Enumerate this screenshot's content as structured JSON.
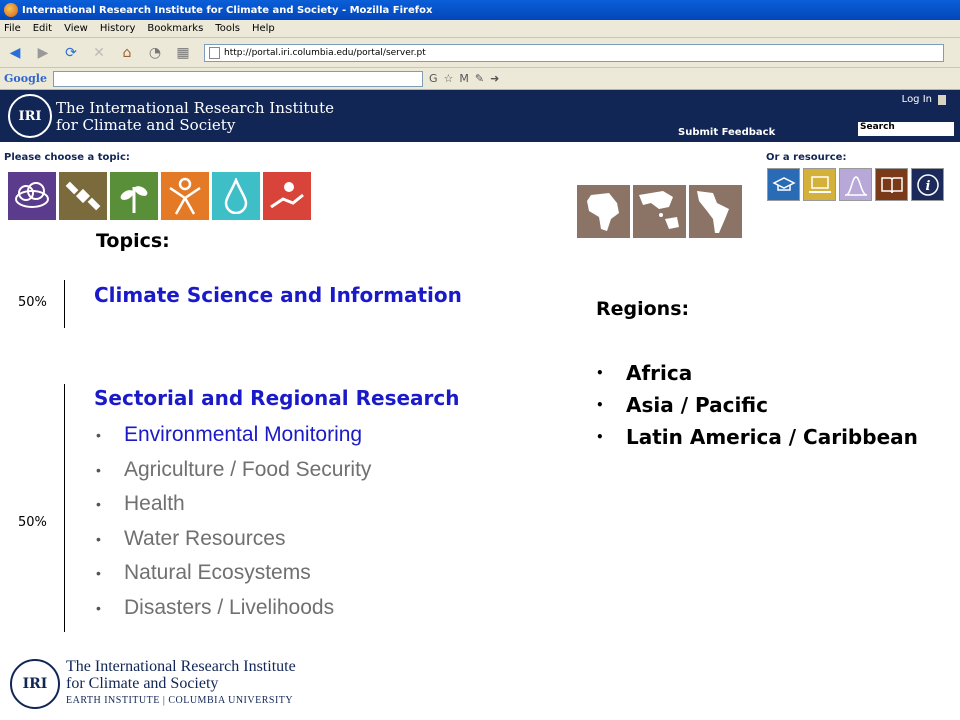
{
  "window": {
    "title": "International Research Institute for Climate and Society - Mozilla Firefox"
  },
  "menu": [
    "File",
    "Edit",
    "View",
    "History",
    "Bookmarks",
    "Tools",
    "Help"
  ],
  "nav": {
    "url": "http://portal.iri.columbia.edu/portal/server.pt"
  },
  "google": {
    "label": "Google"
  },
  "header": {
    "org_line1": "The International Research Institute",
    "org_line2": "for Climate and Society",
    "logo_text": "IRI",
    "login": "Log In",
    "feedback": "Submit Feedback",
    "search_placeholder": "Search"
  },
  "choose_topic_label": "Please choose a topic:",
  "resource_label": "Or a resource:",
  "topic_icons": [
    {
      "name": "cloud-icon",
      "color": "#5b3b8c"
    },
    {
      "name": "satellite-icon",
      "color": "#7b6a3c"
    },
    {
      "name": "plant-icon",
      "color": "#5a8f3a"
    },
    {
      "name": "person-icon",
      "color": "#e47a26"
    },
    {
      "name": "water-drop-icon",
      "color": "#3ebfc8"
    },
    {
      "name": "hands-icon",
      "color": "#d8443a"
    }
  ],
  "resource_icons": [
    {
      "name": "graduation-cap-icon",
      "color": "#2a6bb5"
    },
    {
      "name": "laptop-icon",
      "color": "#d4b13a"
    },
    {
      "name": "graph-icon",
      "color": "#b7a8d8"
    },
    {
      "name": "book-icon",
      "color": "#7a3a1a"
    },
    {
      "name": "info-icon",
      "color": "#1b2a5a"
    }
  ],
  "region_icons": [
    "africa-map-icon",
    "asia-pacific-map-icon",
    "latin-america-map-icon"
  ],
  "topics": {
    "heading": "Topics:",
    "pct_top": "50%",
    "pct_bottom": "50%",
    "cat1": "Climate Science and Information",
    "cat2": "Sectorial and Regional Research",
    "items": [
      "Environmental Monitoring",
      "Agriculture / Food Security",
      "Health",
      "Water Resources",
      "Natural Ecosystems",
      "Disasters / Livelihoods"
    ]
  },
  "regions": {
    "heading": "Regions:",
    "items": [
      "Africa",
      "Asia / Pacific",
      "Latin America / Caribbean"
    ]
  },
  "footer": {
    "logo_text": "IRI",
    "line1": "The International Research Institute",
    "line2": "for Climate and Society",
    "line3": "EARTH INSTITUTE | COLUMBIA UNIVERSITY"
  }
}
